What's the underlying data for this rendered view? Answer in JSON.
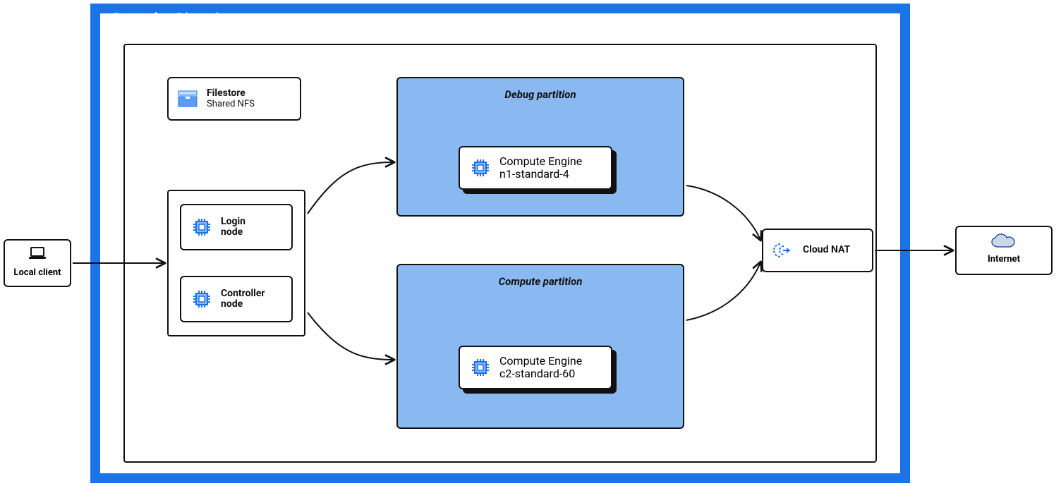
{
  "cloud": {
    "brand_bold": "Google",
    "brand_light": " Cloud"
  },
  "local": {
    "label": "Local client"
  },
  "filestore": {
    "title": "Filestore",
    "sub": "Shared NFS"
  },
  "nodes": {
    "login": {
      "title": "Login",
      "sub": "node"
    },
    "controller": {
      "title": "Controller",
      "sub": "node"
    }
  },
  "partitions": {
    "debug": {
      "title": "Debug partition",
      "engine": {
        "title": "Compute Engine",
        "sub": "n1-standard-4"
      }
    },
    "compute": {
      "title": "Compute partition",
      "engine": {
        "title": "Compute Engine",
        "sub": "c2-standard-60"
      }
    }
  },
  "nat": {
    "title": "Cloud NAT"
  },
  "internet": {
    "title": "Internet"
  },
  "colors": {
    "brand_blue": "#1A73E8",
    "partition_fill": "#8AB9F1"
  }
}
